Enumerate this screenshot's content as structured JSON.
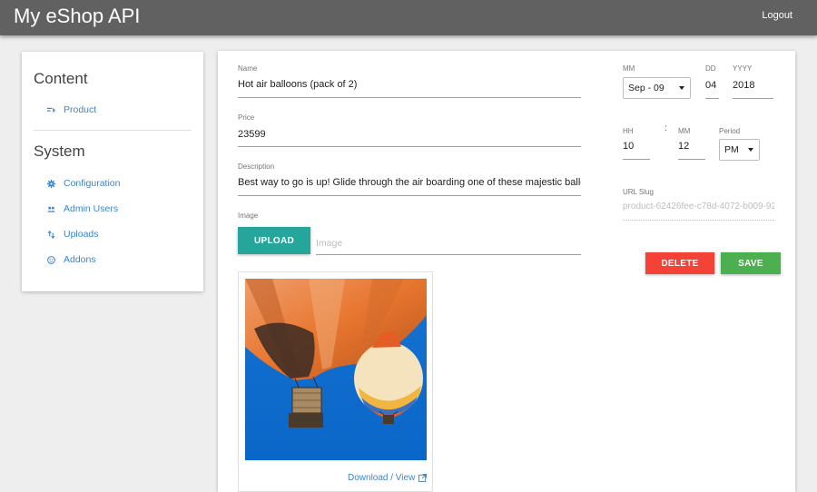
{
  "header": {
    "title": "My eShop API",
    "logout_label": "Logout"
  },
  "sidebar": {
    "content_heading": "Content",
    "content_items": [
      {
        "label": "Product",
        "icon": "sort-list-icon"
      }
    ],
    "system_heading": "System",
    "system_items": [
      {
        "label": "Configuration",
        "icon": "gear-icon"
      },
      {
        "label": "Admin Users",
        "icon": "users-icon"
      },
      {
        "label": "Uploads",
        "icon": "swap-vertical-icon"
      },
      {
        "label": "Addons",
        "icon": "face-icon"
      }
    ]
  },
  "form": {
    "name_label": "Name",
    "name_value": "Hot air balloons (pack of 2)",
    "price_label": "Price",
    "price_value": "23599",
    "description_label": "Description",
    "description_value": "Best way to go is up! Glide through the air boarding one of these majestic balloons.",
    "image_label": "Image",
    "upload_label": "UPLOAD",
    "image_placeholder": "Image",
    "download_label": "Download / View"
  },
  "date": {
    "month_label": "MM",
    "month_value": "Sep - 09",
    "day_label": "DD",
    "day_value": "04",
    "year_label": "YYYY",
    "year_value": "2018"
  },
  "time": {
    "hour_label": "HH",
    "hour_value": "10",
    "separator": ":",
    "minute_label": "MM",
    "minute_value": "12",
    "period_label": "Period",
    "period_value": "PM"
  },
  "slug": {
    "label": "URL Slug",
    "value": "product-62426fee-c78d-4072-b009-92"
  },
  "actions": {
    "delete_label": "DELETE",
    "save_label": "SAVE"
  },
  "colors": {
    "topbar": "#616161",
    "accent_teal": "#26a69a",
    "delete_red": "#f44336",
    "save_green": "#4caf50",
    "link_blue": "#3d85c6"
  }
}
